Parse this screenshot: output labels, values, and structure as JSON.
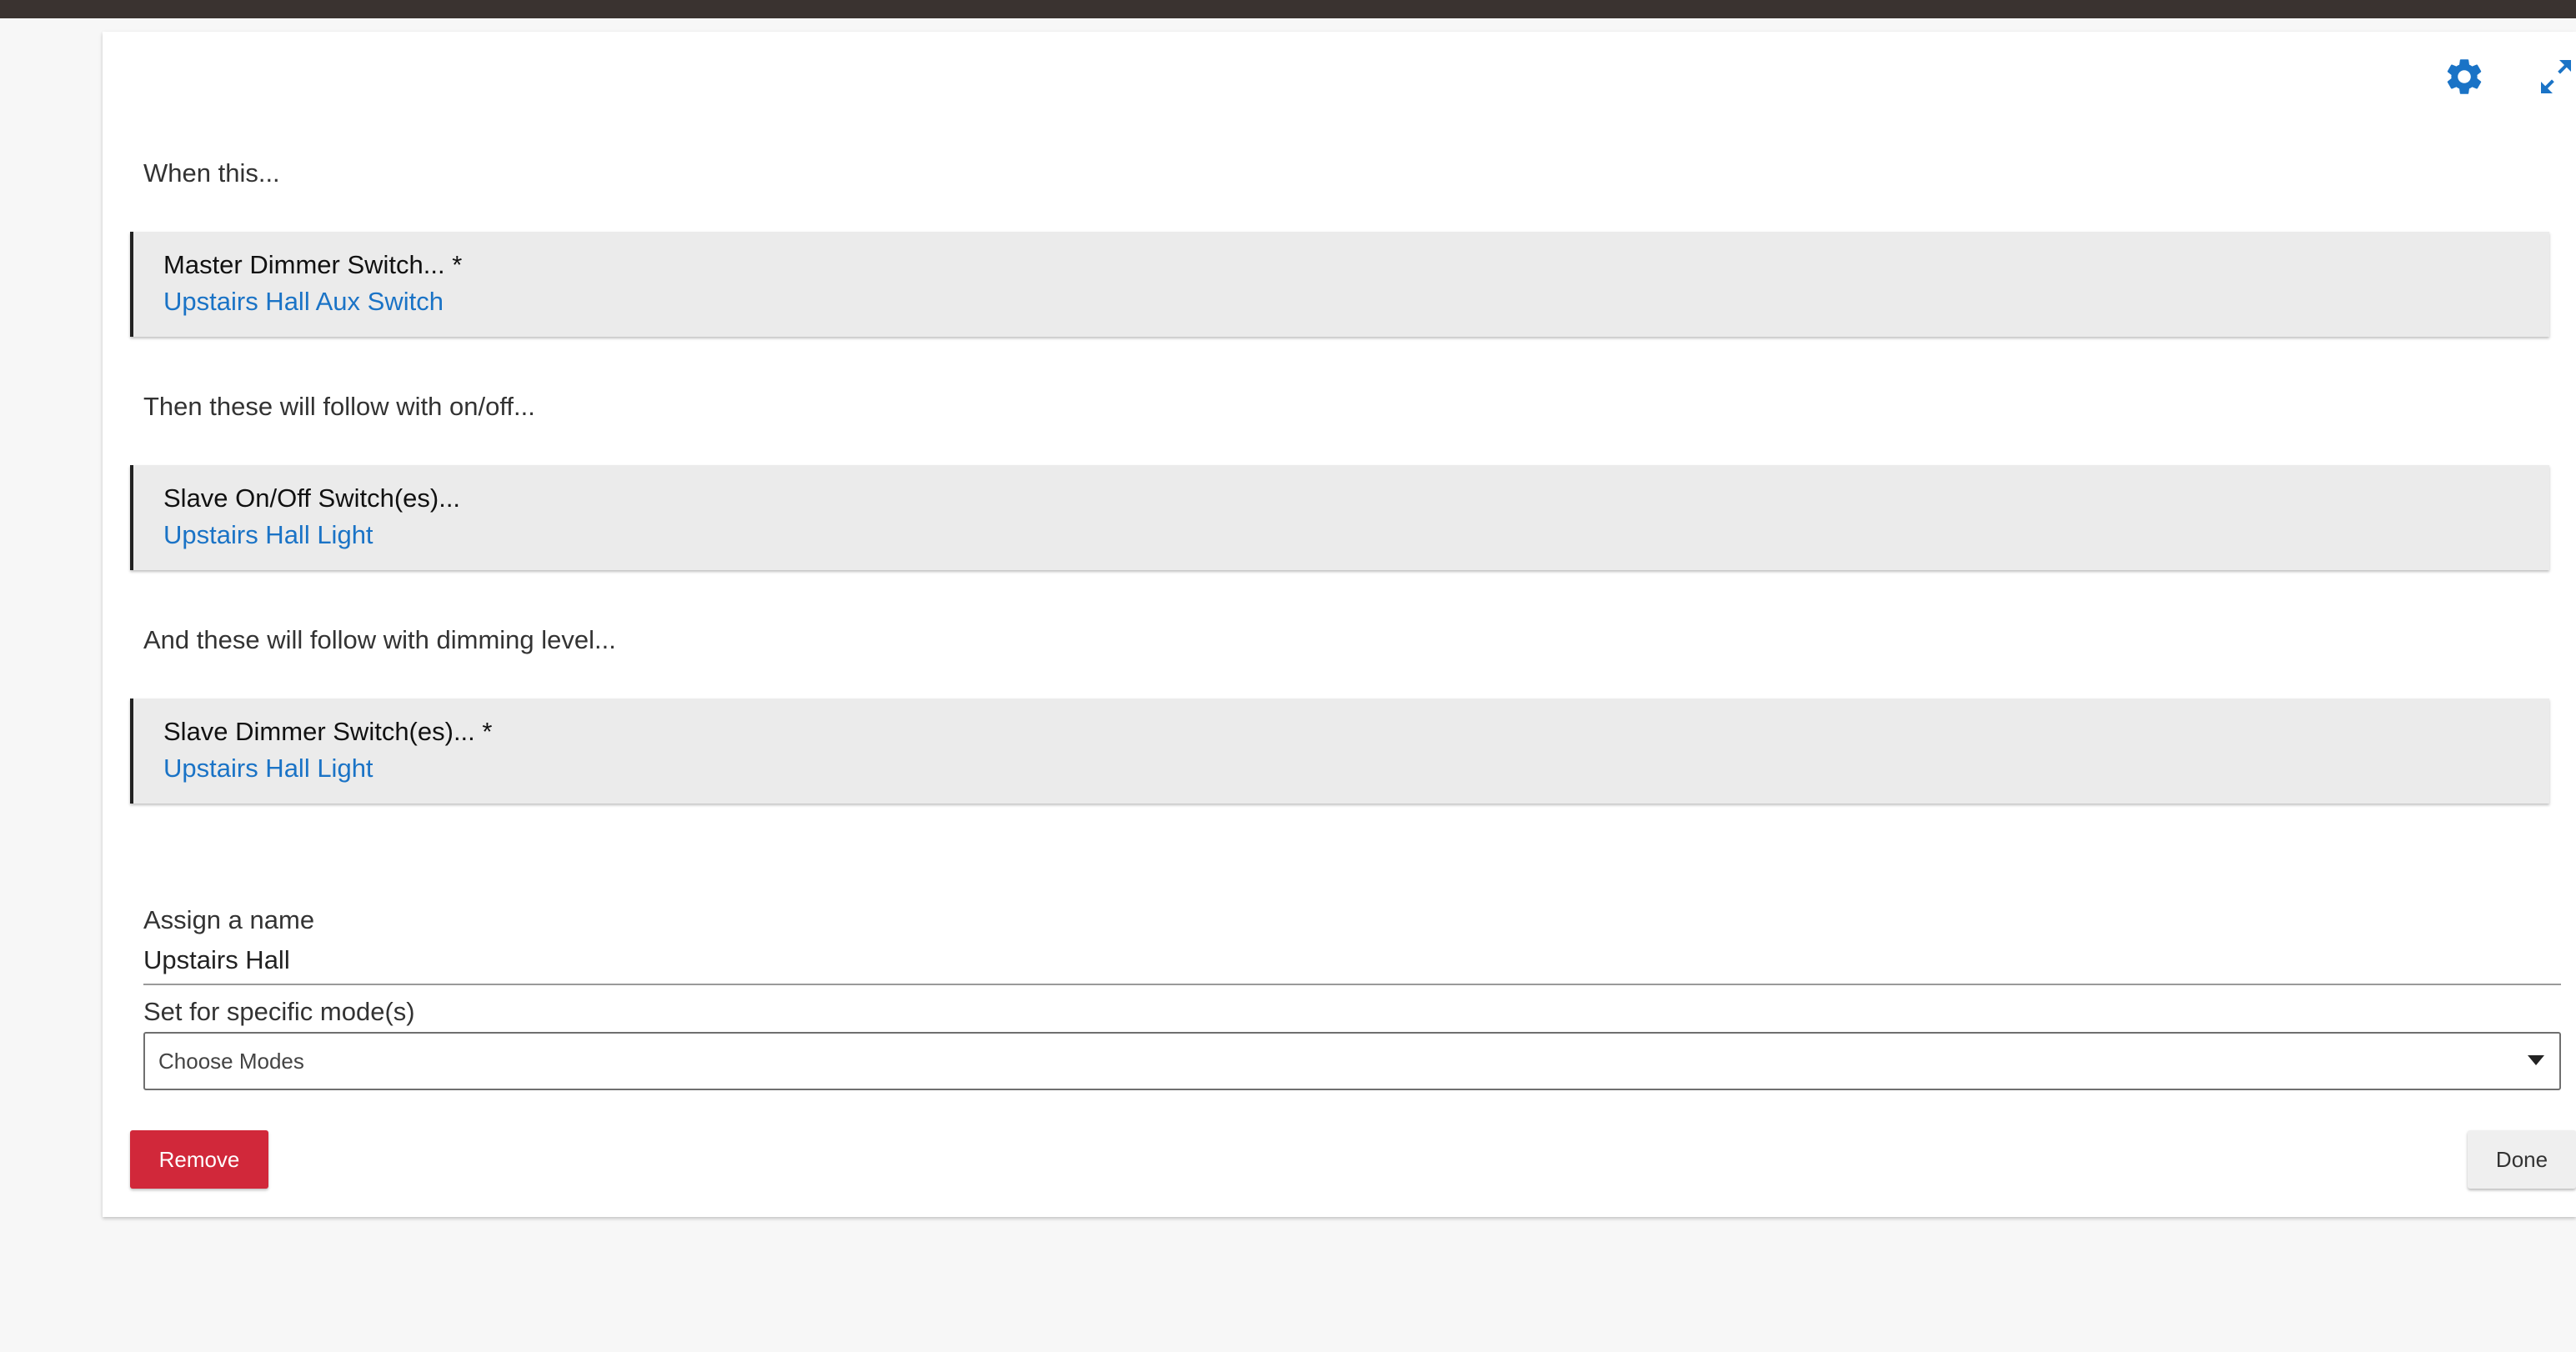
{
  "header": {
    "settings_icon": "gear-icon",
    "expand_icon": "expand-arrows-icon",
    "accent_color": "#1a73c6"
  },
  "sections": {
    "when_label": "When this...",
    "master": {
      "title": "Master Dimmer Switch... *",
      "value": "Upstairs Hall Aux Switch"
    },
    "then_label": "Then these will follow with on/off...",
    "slave_onoff": {
      "title": "Slave On/Off Switch(es)...",
      "value": "Upstairs Hall Light"
    },
    "and_label": "And these will follow with dimming level...",
    "slave_dimmer": {
      "title": "Slave Dimmer Switch(es)... *",
      "value": "Upstairs Hall Light"
    }
  },
  "name_field": {
    "label": "Assign a name",
    "value": "Upstairs Hall"
  },
  "modes_field": {
    "label": "Set for specific mode(s)",
    "selected": "Choose Modes"
  },
  "buttons": {
    "remove_label": "Remove",
    "remove_color": "#d1283a",
    "done_label": "Done"
  }
}
